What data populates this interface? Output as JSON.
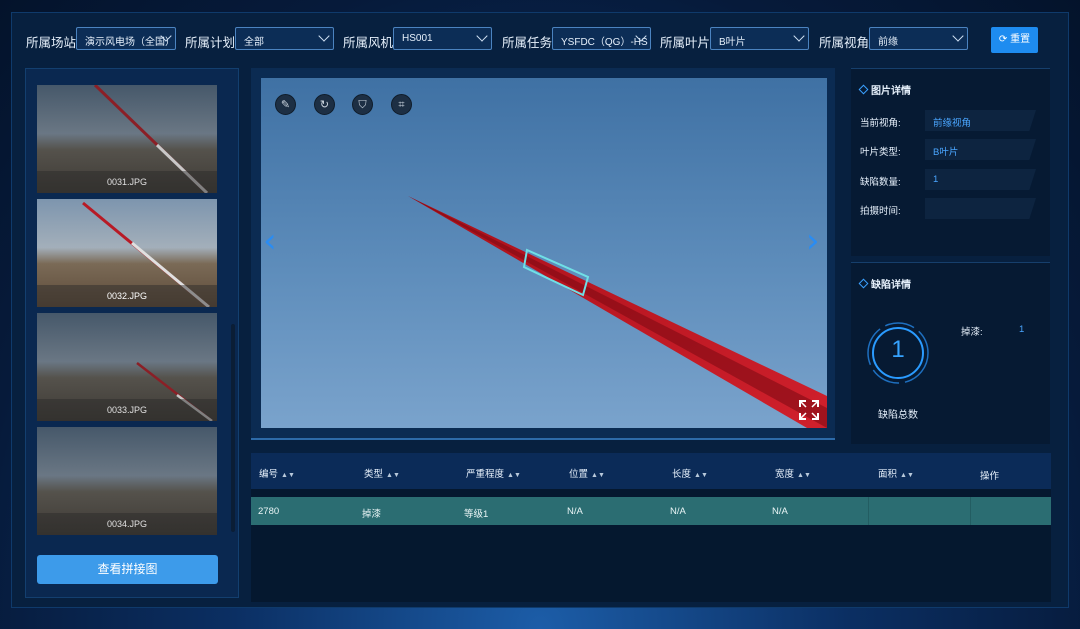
{
  "filters": [
    {
      "label": "所属场站",
      "value": "演示风电场（全国）"
    },
    {
      "label": "所属计划",
      "value": "全部"
    },
    {
      "label": "所属风机",
      "value": "HS001"
    },
    {
      "label": "所属任务",
      "value": "YSFDC（QG）-HS"
    },
    {
      "label": "所属叶片",
      "value": "B叶片"
    },
    {
      "label": "所属视角",
      "value": "前缘"
    }
  ],
  "reset_label": "重置",
  "thumbnails": [
    {
      "name": "0031.JPG"
    },
    {
      "name": "0032.JPG"
    },
    {
      "name": "0033.JPG"
    },
    {
      "name": "0034.JPG"
    }
  ],
  "stitch_button": "查看拼接图",
  "viewer": {
    "tools": [
      "edit-icon",
      "rotate-icon",
      "filter-icon",
      "crop-icon"
    ],
    "prev": "‹",
    "next": "›"
  },
  "image_details": {
    "title": "图片详情",
    "rows": [
      {
        "label": "当前视角:",
        "value": "前缘视角"
      },
      {
        "label": "叶片类型:",
        "value": "B叶片"
      },
      {
        "label": "缺陷数量:",
        "value": "1"
      },
      {
        "label": "拍摄时间:",
        "value": ""
      }
    ]
  },
  "defect_details": {
    "title": "缺陷详情",
    "total": "1",
    "total_label": "缺陷总数",
    "types": [
      {
        "label": "掉漆:",
        "count": "1"
      }
    ]
  },
  "table": {
    "headers": [
      "编号",
      "类型",
      "严重程度",
      "位置",
      "长度",
      "宽度",
      "面积",
      "操作"
    ],
    "rows": [
      [
        "2780",
        "掉漆",
        "等级1",
        "N/A",
        "N/A",
        "N/A",
        "",
        ""
      ]
    ]
  },
  "colors": {
    "accent": "#1e8cf0",
    "blade": "#c0121e",
    "highlight_row": "#2b6d72"
  }
}
